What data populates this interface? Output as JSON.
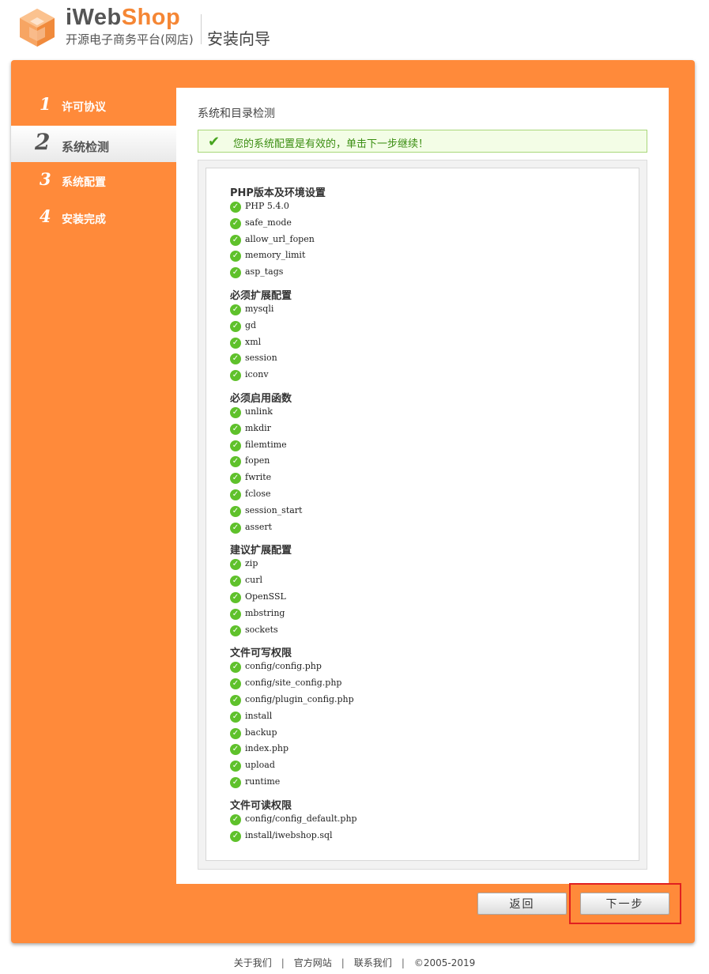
{
  "header": {
    "brand_main": "iWeb",
    "brand_accent": "Shop",
    "slogan": "开源电子商务平台(网店)",
    "wizard_title": "安装向导"
  },
  "colors": {
    "accent": "#ff8a3a",
    "success": "#5fc12b",
    "highlight": "#e12020"
  },
  "steps": [
    {
      "num": "1",
      "label": "许可协议",
      "active": false
    },
    {
      "num": "2",
      "label": "系统检测",
      "active": true
    },
    {
      "num": "3",
      "label": "系统配置",
      "active": false
    },
    {
      "num": "4",
      "label": "安装完成",
      "active": false
    }
  ],
  "content": {
    "title": "系统和目录检测",
    "notice_icon": "✔",
    "notice": "您的系统配置是有效的，单击下一步继续！"
  },
  "groups": [
    {
      "title": "PHP版本及环境设置",
      "items": [
        "PHP 5.4.0",
        "safe_mode",
        "allow_url_fopen",
        "memory_limit",
        "asp_tags"
      ]
    },
    {
      "title": "必须扩展配置",
      "items": [
        "mysqli",
        "gd",
        "xml",
        "session",
        "iconv"
      ]
    },
    {
      "title": "必须启用函数",
      "items": [
        "unlink",
        "mkdir",
        "filemtime",
        "fopen",
        "fwrite",
        "fclose",
        "session_start",
        "assert"
      ]
    },
    {
      "title": "建议扩展配置",
      "items": [
        "zip",
        "curl",
        "OpenSSL",
        "mbstring",
        "sockets"
      ]
    },
    {
      "title": "文件可写权限",
      "items": [
        "config/config.php",
        "config/site_config.php",
        "config/plugin_config.php",
        "install",
        "backup",
        "index.php",
        "upload",
        "runtime"
      ]
    },
    {
      "title": "文件可读权限",
      "items": [
        "config/config_default.php",
        "install/iwebshop.sql"
      ]
    }
  ],
  "buttons": {
    "back": "返回",
    "next": "下一步"
  },
  "footer": {
    "about": "关于我们",
    "official": "官方网站",
    "contact": "联系我们",
    "copyright": "©2005-2019",
    "separator": "|"
  }
}
